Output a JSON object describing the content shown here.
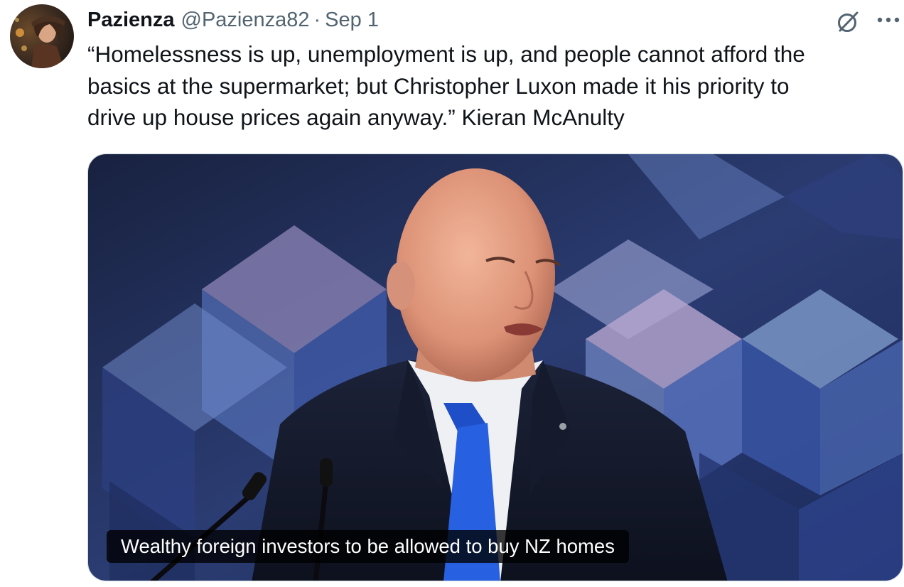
{
  "tweet": {
    "author": {
      "display_name": "Pazienza",
      "handle": "@Pazienza82",
      "separator": "·",
      "date": "Sep 1"
    },
    "text_lines": [
      "“Homelessness is up, unemployment is up, and people cannot afford the",
      "basics at the supermarket; but Christopher Luxon made it his priority to",
      "drive up house prices again anyway.” Kieran McAnulty"
    ],
    "media": {
      "caption": "Wealthy foreign investors to be allowed to buy NZ homes"
    },
    "icons": {
      "grok": "grok-icon",
      "more": "more-icon",
      "avatar": "avatar"
    },
    "colors": {
      "text": "#0f1419",
      "secondary": "#536471",
      "border": "#cfd9de"
    }
  }
}
